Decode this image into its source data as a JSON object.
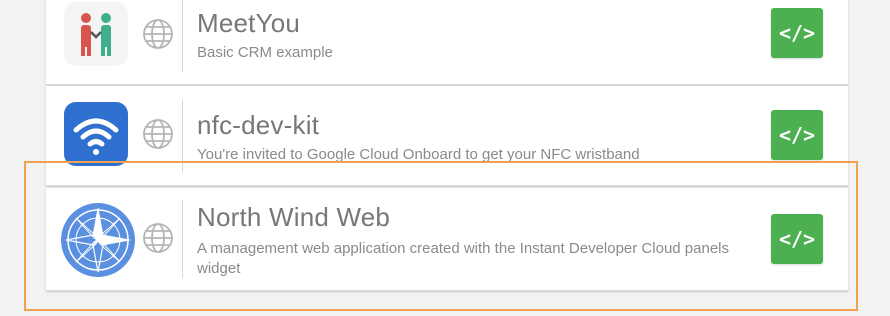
{
  "apps": [
    {
      "name": "MeetYou",
      "description": "Basic CRM example",
      "icon": "meetyou-people-icon",
      "link_icon": "globe-icon",
      "code_button_label": "</>"
    },
    {
      "name": "nfc-dev-kit",
      "description": "You're invited to Google Cloud Onboard to get your NFC wristband",
      "icon": "wifi-icon",
      "link_icon": "globe-icon",
      "code_button_label": "</>"
    },
    {
      "name": "North Wind Web",
      "description": "A management web application created with the Instant Developer Cloud panels widget",
      "icon": "compass-rose-icon",
      "link_icon": "globe-icon",
      "code_button_label": "</>"
    }
  ],
  "colors": {
    "code_button": "#4caf50",
    "highlight_border": "#f0a050",
    "nfc_icon_bg": "#2f6fd0",
    "compass_bg": "#5b8fe0"
  }
}
